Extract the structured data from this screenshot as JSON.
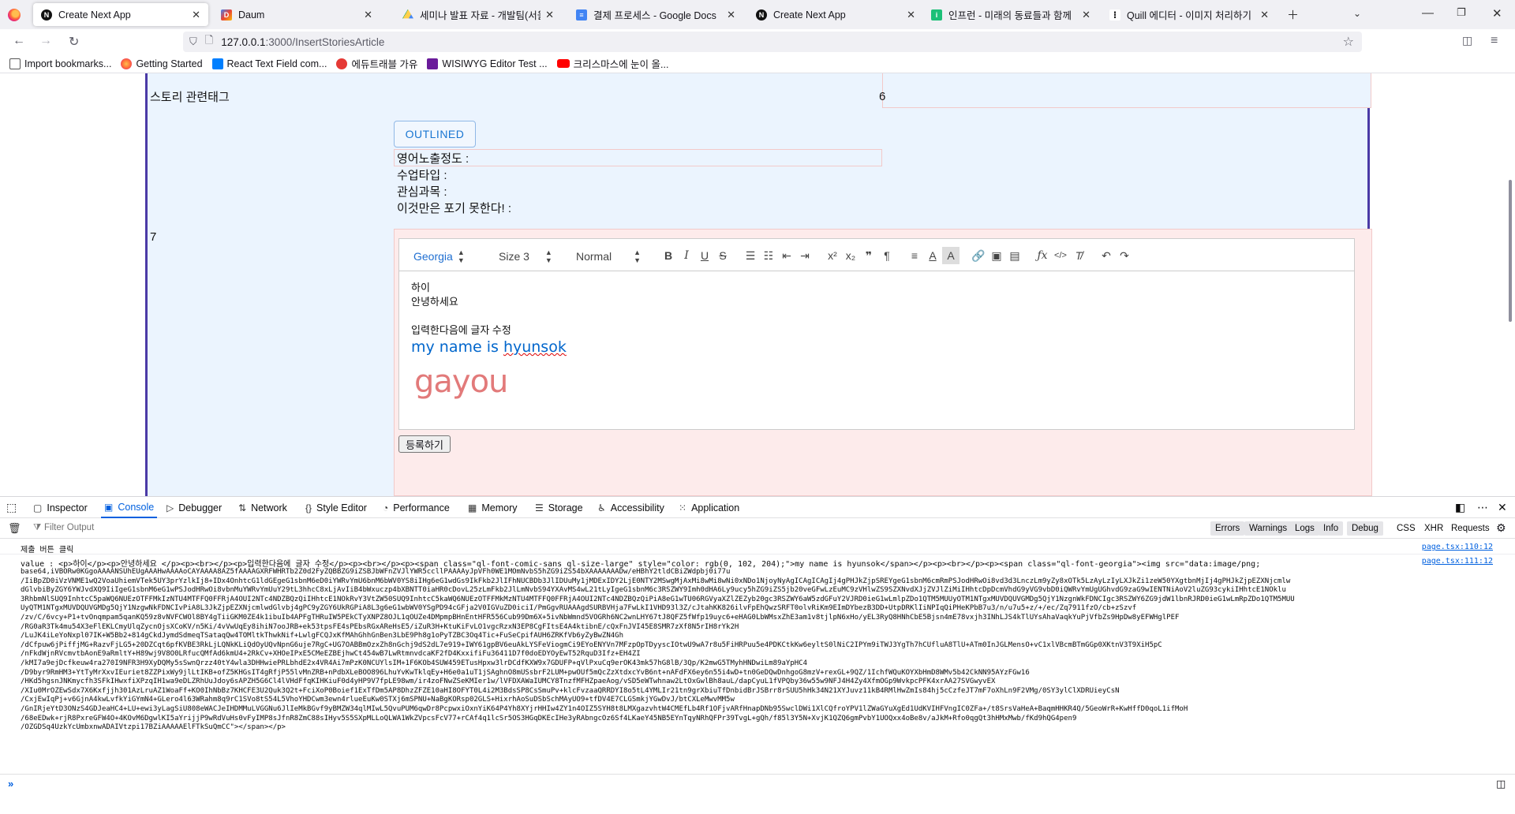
{
  "tabs": [
    {
      "title": "Create Next App",
      "favicon": "nextjs-icon",
      "active": true
    },
    {
      "title": "Daum",
      "favicon": "daum-icon",
      "active": false
    },
    {
      "title": "세미나 발표 자료 - 개발팀(서울",
      "favicon": "google-drive-icon",
      "active": false
    },
    {
      "title": "결제 프로세스 - Google Docs",
      "favicon": "google-docs-icon",
      "active": false
    },
    {
      "title": "Create Next App",
      "favicon": "nextjs-icon",
      "active": false
    },
    {
      "title": "인프런 - 미래의 동료들과 함께",
      "favicon": "inflearn-icon",
      "active": false
    },
    {
      "title": "Quill 에디터 - 이미지 처리하기",
      "favicon": "velog-icon",
      "active": false
    }
  ],
  "url": {
    "host": "127.0.0.1",
    "path": ":3000/InsertStoriesArticle"
  },
  "bookmarks": [
    {
      "label": "Import bookmarks...",
      "icon": "import-icon"
    },
    {
      "label": "Getting Started",
      "icon": "firefox-icon"
    },
    {
      "label": "React Text Field com...",
      "icon": "mui-icon"
    },
    {
      "label": "에듀트래블 가유",
      "icon": "edu-icon"
    },
    {
      "label": "WISIWYG Editor Test ...",
      "icon": "wisiwyg-icon"
    },
    {
      "label": "크리스마스에 눈이 올...",
      "icon": "youtube-icon"
    }
  ],
  "form": {
    "story_tag_label": "스토리 관련태그",
    "row6": "6",
    "row7": "7",
    "outlined_button": "OUTLINED",
    "prefs": [
      "영어노출정도 :",
      "수업타입 :",
      "관심과목 :",
      "이것만은 포기 못한다! :"
    ],
    "submit": "등록하기"
  },
  "editor": {
    "font": "Georgia",
    "size": "Size 3",
    "heading": "Normal",
    "lines": [
      "하이",
      "안녕하세요",
      "입력한다음에 글자 수정"
    ],
    "name_prefix": "my name is ",
    "name_word": "hyunsok",
    "name_color": "#0066cc",
    "logo_text": "gayou"
  },
  "devtools": {
    "tabs": [
      "Inspector",
      "Console",
      "Debugger",
      "Network",
      "Style Editor",
      "Performance",
      "Memory",
      "Storage",
      "Accessibility",
      "Application"
    ],
    "active_tab": "Console",
    "filter_placeholder": "Filter Output",
    "filters": [
      "Errors",
      "Warnings",
      "Logs",
      "Info",
      "Debug"
    ],
    "filters_plain": [
      "CSS",
      "XHR",
      "Requests"
    ],
    "log1": "제출 버튼 클릭",
    "log1_src": "page.tsx:110:12",
    "log2": "value :  <p>하이</p><p>안녕하세요 </p><p><br></p><p>입력한다음에 글자 수정</p><p><br></p><p><span class=\"ql-font-comic-sans ql-size-large\" style=\"color: rgb(0, 102, 204);\">my name is hyunsok</span></p><p><br></p><p><span class=\"ql-font-georgia\"><img src=\"data:image/png;",
    "log2_src": "page.tsx:111:12",
    "blob": "base64,iVBORw0KGgoAAAANSUhEUgAAAHwAAAAoCAYAAAA8AZ5fAAAAGXRFWHRTb2Z0d2FyZQBBZG9iZSBJbWFnZVJlYWR5ccllPAAAAyJpVFh0WE1MOmNvbS5hZG9iZS54bXAAAAAAADw/eHBhY2tldCBiZWdpbj0i77u\n/IiBpZD0iVzVNME1wQ2VoaUhiemVTek5UY3prYzlkIj8+IDx4OnhtcG1ldGEgeG1sbnM6eD0iYWRvYmU6bnM6bWV0YS8iIHg6eG1wdGs9IkFkb2JlIFhNUCBDb3JlIDUuMy1jMDExIDY2LjE0NTY2MSwgMjAxMi8wMi8wNi0xNDo1NjoyNyAgICAgICAgIj4gPHJkZjpSREYgeG1sbnM6cmRmPSJodHRwOi8vd3d3LnczLm9yZy8xOTk5LzAyLzIyLXJkZi1zeW50YXgtbnMjIj4gPHJkZjpEZXNjcmlw\ndGlvbiByZGY6YWJvdXQ9IiIgeG1sbnM6eG1wPSJodHRwOi8vbnMuYWRvYmUuY29tL3hhcC8xLjAvIiB4bWxuczp4bXBNTT0iaHR0cDovL25zLmFkb2JlLmNvbS94YXAvMS4wL21tLyIgeG1sbnM6c3RSZWY9Imh0dHA6Ly9ucy5hZG9iZS5jb20veGFwLzEuMC9zVHlwZS9SZXNvdXJjZVJlZiMiIHhtcDpDcmVhdG9yVG9vbD0iQWRvYmUgUGhvdG9zaG9wIENTNiAoV2luZG93cykiIHhtcE1NOklu\n3RhbmNlSUQ9InhtcC5paWQ6NUEzOTFFMkIzNTU4MTFFQ0FFRjA4OUI2NTc4NDZBQzQiIHhtcE1NOkRvY3VtZW50SUQ9InhtcC5kaWQ6NUEzOTFFMkMzNTU4MTFFQ0FFRjA4OUI2NTc4NDZBQzQiPiA8eG1wTU06RGVyaXZlZEZyb20gc3RSZWY6aW5zdGFuY2VJRD0ieG1wLmlpZDo1QTM5MUUyOTM1NTgxMUVDQUVGMDg5QjY1NzgnWkFDNCIgc3RSZWY6ZG9jdW1lbnRJRD0ieG1wLmRpZDo1QTM5MUU\nUyQTM1NTgxMUVDQUVGMDg5QjY1NzgwNkFDNCIvPiA8L3JkZjpEZXNjcmlwdGlvbj4gPC9yZGY6UkRGPiA8L3g6eG1wbWV0YSgPD94cGFja2V0IGVuZD0iciI/PmGgvRUAAAgdSURBVHja7FwLkI1VHD93l3Z/cJtahKK826ilvFpEhQwzSRFT0olvRiKm9EImDYbezB3DD+UtpDRKlIiNPIqQiPHeKPbB7u3/n/u7u5+z/+/ec/Zq7911fzO/cb+zSzvf\n/zv/C/6vcy+P1+tvOnqmpam5qanKQ59z8vNVFCWOl8BY4gTiiGKM0ZE4k1ibuIb4APFgTHRuIW5PEkCTyXNPZ8OJL1qOUZe4DMpmpBHnEntHFR556Cub99Dm6X+5ivNbWmnd5VOGRh6NC2wnLHY67tJ8QFZ5fWfp19uyc6+eHAG0LbWMsxZhE3am1v8tjlpN6xHo/yEL3RyQ8HNhCbE5Bjsn4mE78vxjh3INhLJS4kTlUYsAhaVaqkYuPjVfbZs9HpDw8yEFWHglPEF\n/RG0aR3Tk4mu54X3eFlEKLCmyUlqZycnOjsXCoKV/n5Ki/4vVwUqEy8ihiN7ooJRB+ek53tpsFE4sPEbsRGxAReHsE5/iZuR3H+KtuKiFvLO1vgcRzxN3EP8CgFItsE4A4ktibnE/cQxFnJVI45E8SMR7zXf8N5rIH8rYk2H\n/LuJK4iLeYoNxpl07IK+W5Bb2+814gCkdJymdSdmeqTSataqQw4TOMltkThwkNif+LwlgFCQJxKfMAhGhhGnBen3LbE9Ph8g1oPyTZBC3Oq4Tic+FuSeCpifAUH6ZRKfVb6yZyBwZN4Gh\n/dCfpuw6jPiffjMG+RazvFjLG5+20DZCqt6pfKVBE3RkLjLQNkKLiQdOyUQvNpnG6uje7RgC+UG7OABBmOzxZh8nGchj9dS2dL7e919+IWY61gpBV6euAkLYSFeViogmCi9EYoENYVn7MFzpOpTDyyscIOtwU9wA7r8u5FiHRPuu5e4PDKCtkKw6eyltS0lNiC2IPYm9iTWJ3YgTh7hCUfluA8TlU+ATm0InJGLMensO+vC1xlVBcmBTmGGp0XKtnV3T9XiH5pC\n/nFkdWjnRVcmvtbAonE9aRmltY+H89wj9V8O0LRfucQMfAd6kmU4+2RkCv+XHOeIPxE5CMeEZBEjhwCt454wB7LwRtmnvdcaKF2fD4KxxifiFu36411D7f0doEDYOyEwT52RquD3Ifz+EH4ZI\n/kMI7a9ejDcfkeuw4ra270I9NFR3H9XyDQMy5sSwnQrzz40tY4wla3DHHwiePRLbhdE2x4VR4Ai7mPzK0NCUYlsIM+1F6KOb4SUW459ETusHpxw3lrDCdfKXW9x7GDUFP+qVlPxuCq9erOK43mk57hG8lB/3Qp/K2mwG5TMyhHNDwiLm89aYpHC4\n/D9byr9RmHM3+YtTyMrXxvIEuriet8ZZPixWy9jlLtIKB+ofZ5KHGsIT4gRfjP55lvMnZRB+nPdbXLeBOO896LhuYvKwTklqEy+H6e0a1uT1jSAghnO8mUSsbrF2LUM+pwOUf5mQcZzXtdxcYvB6nt+nAFdFX6ey6n55i4wD+tn0GeDQwDnhgoG8mzV+rexGL+9QZ/1IchfWQuKOYXbHmD8WMv5b42CkNN95AYzFGw16\n/HKd5hgsnJNKmycfh3SFkIHwxfiXPzqIH1wa9eDLZRhUuJdoy6sAPZH5G6Cl4lVHdFfqKIHKiuF0d4yHP9V7fpLE98wm/ir4zoFNwZSeKMIer1w/lVFDXAWaIUMCY8TnzfMFHZpaeAog/vSD5eWTwhnaw2LtOxGwlBh8auL/dapCyuL1fVPQby36w55w9NFJ4H4Zy4XfmOGp9WvkpcPFK4xrAA27SVGwyvEX\n/XIu0MrOZEwSdx7X6Kxfjjh301AzLruAZ1WoaFf+KO0IhNbBz7KHCFE3U2Quk3Q2t+FciXoP0Boief1ExTfDm5AP8DhzZFZE10aHI8OFYT0L4i2M3BdsSP8CsSmuPv+klcFvzaaQRRDYI8o5tL4YMLIr21tn9grXbiuTfDnbidBrJSBrr8rSUU5hHk34N21XYJuvz11kB4RMlHwZmIs84hj5cCzfeJT7mF7oXhLn9F2VMg/0SY3ylClXDRUieyCsN\n/CxjEwIqPj+v6GjnA4kwLvfkYiGYmN4+GLero4l63WRahm8q9rC1SVo8tS54L5VhoYHDCwm3ewn4rlueEuKw0STXj6mSPNU+NaBgKORsp02GLS+HixrhAoSuDSbSchMAyUO9+tfDV4E7CLGSmkjYGwDvJ/btCXLeMwvMM5w\n/GnIRjeYtD3ONzS4GDJeaHC4+LU+ewi3yLagSiU808eWACJeIHDMMuLVGGNu6JlIeMkBGvf9yBMZW34qlMIwL5QvuPUM6qwDr8PcpwxiOxnYiK64P4Yh8XYjrHHIw4ZY1n4OIZ5SYH8t8LMXgazvhtW4CMEfLb4Rf1OFjvARfHnapDNb95SwclDWi1XlCQfroYPV1lZWaGYuXgEd1UdKVIHFVngIC0ZFa+/t8SrsVaHeA+BaqmHHKR4Q/5GeoWrR+KwHffD0qoL1ifMoH\n/68eEDwk+rjR8PxreGFW4O+4KOvM6DgwlKI5aYrijjP9wRdVuHs0vFyIMP8sJfnR8ZmC88sIHyv5S5SXpMLLoQLWA1WkZVpcsFcV77+rCAf4q1lcSr5OS3HGqDKEcIHe3yRAbngcOz6Sf4LKaeY45NB5EYnTqyNRhQFPr39TvgL+gQh/f85l3Y5N+XvjK1QZQ6gmPvbY1UOQxx4oBe8v/aJkM+Rfo0qgQt3hHMxMwb/fKd9hQG4pen9\n/OZGDSq4UzkYcUmbxnwADAIVtzpi17BZiAAAAAElFTkSuQmCC\"></span></p>"
  }
}
